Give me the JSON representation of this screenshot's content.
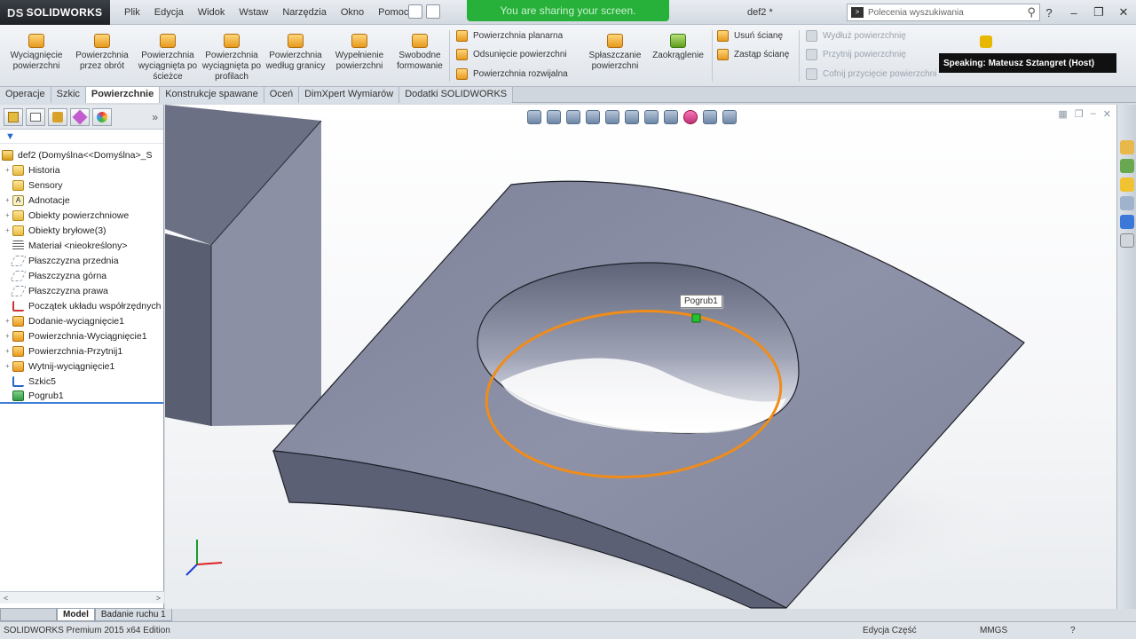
{
  "app": {
    "logo_text": "SOLIDWORKS",
    "logo_mark": "DS",
    "document_title": "def2 *"
  },
  "menu": [
    "Plik",
    "Edycja",
    "Widok",
    "Wstaw",
    "Narzędzia",
    "Okno",
    "Pomoc"
  ],
  "sharing_banner": "You are sharing your screen.",
  "search": {
    "placeholder": "Polecenia wyszukiwania"
  },
  "ribbon": {
    "large_buttons": [
      {
        "label": "Wyciągnięcie powierzchni",
        "icon": "extruded-surface-icon"
      },
      {
        "label": "Powierzchnia przez obrót",
        "icon": "revolved-surface-icon"
      },
      {
        "label": "Powierzchnia wyciągnięta po ścieżce",
        "icon": "swept-surface-icon"
      },
      {
        "label": "Powierzchnia wyciągnięta po profilach",
        "icon": "lofted-surface-icon"
      },
      {
        "label": "Powierzchnia według granicy",
        "icon": "boundary-surface-icon"
      },
      {
        "label": "Wypełnienie powierzchni",
        "icon": "filled-surface-icon"
      },
      {
        "label": "Swobodne formowanie",
        "icon": "freeform-icon"
      }
    ],
    "group1": [
      "Powierzchnia planarna",
      "Odsunięcie powierzchni",
      "Powierzchnia rozwijalna"
    ],
    "flatten": "Spłaszczanie powierzchni",
    "fillet": "Zaokrąglenie",
    "group2": [
      "Usuń ścianę",
      "Zastąp ścianę"
    ],
    "group3_disabled": [
      "Wydłuż powierzchnię",
      "Przytnij powierzchnię",
      "Cofnij przycięcie powierzchni"
    ]
  },
  "speaking": "Speaking: Mateusz Sztangret (Host)",
  "tabs": [
    {
      "label": "Operacje",
      "active": false
    },
    {
      "label": "Szkic",
      "active": false
    },
    {
      "label": "Powierzchnie",
      "active": true
    },
    {
      "label": "Konstrukcje spawane",
      "active": false
    },
    {
      "label": "Oceń",
      "active": false
    },
    {
      "label": "DimXpert Wymiarów",
      "active": false
    },
    {
      "label": "Dodatki SOLIDWORKS",
      "active": false
    }
  ],
  "tree": {
    "root": "def2 (Domyślna<<Domyślna>_S",
    "items": [
      {
        "label": "Historia",
        "icon": "history-folder-icon",
        "expandable": true
      },
      {
        "label": "Sensory",
        "icon": "sensors-folder-icon",
        "expandable": false
      },
      {
        "label": "Adnotacje",
        "icon": "annotations-icon",
        "expandable": true
      },
      {
        "label": "Obiekty powierzchniowe",
        "icon": "surface-bodies-folder-icon",
        "expandable": true
      },
      {
        "label": "Obiekty bryłowe(3)",
        "icon": "solid-bodies-folder-icon",
        "expandable": true
      },
      {
        "label": "Materiał <nieokreślony>",
        "icon": "material-icon",
        "expandable": false
      },
      {
        "label": "Płaszczyzna przednia",
        "icon": "plane-icon",
        "expandable": false
      },
      {
        "label": "Płaszczyzna górna",
        "icon": "plane-icon",
        "expandable": false
      },
      {
        "label": "Płaszczyzna prawa",
        "icon": "plane-icon",
        "expandable": false
      },
      {
        "label": "Początek układu współrzędnych",
        "icon": "origin-icon",
        "expandable": false
      },
      {
        "label": "Dodanie-wyciągnięcie1",
        "icon": "extrude-feature-icon",
        "expandable": true
      },
      {
        "label": "Powierzchnia-Wyciągnięcie1",
        "icon": "surface-extrude-icon",
        "expandable": true
      },
      {
        "label": "Powierzchnia-Przytnij1",
        "icon": "surface-trim-icon",
        "expandable": true
      },
      {
        "label": "Wytnij-wyciągnięcie1",
        "icon": "cut-extrude-icon",
        "expandable": true
      },
      {
        "label": "Szkic5",
        "icon": "sketch-icon",
        "expandable": false
      },
      {
        "label": "Pogrub1",
        "icon": "thicken-icon",
        "expandable": false
      }
    ]
  },
  "bottom_tabs": [
    {
      "label": "Model",
      "active": true
    },
    {
      "label": "Badanie ruchu 1",
      "active": false
    }
  ],
  "viewport": {
    "callout": "Pogrub1"
  },
  "status": {
    "edition": "SOLIDWORKS Premium 2015 x64 Edition",
    "mode": "Edycja Część",
    "units": "MMGS"
  },
  "colors": {
    "accent": "#3d7fd8",
    "share_green": "#27b13a",
    "highlight_orange": "#f08c1a",
    "model_fill": "#8d91a6"
  }
}
